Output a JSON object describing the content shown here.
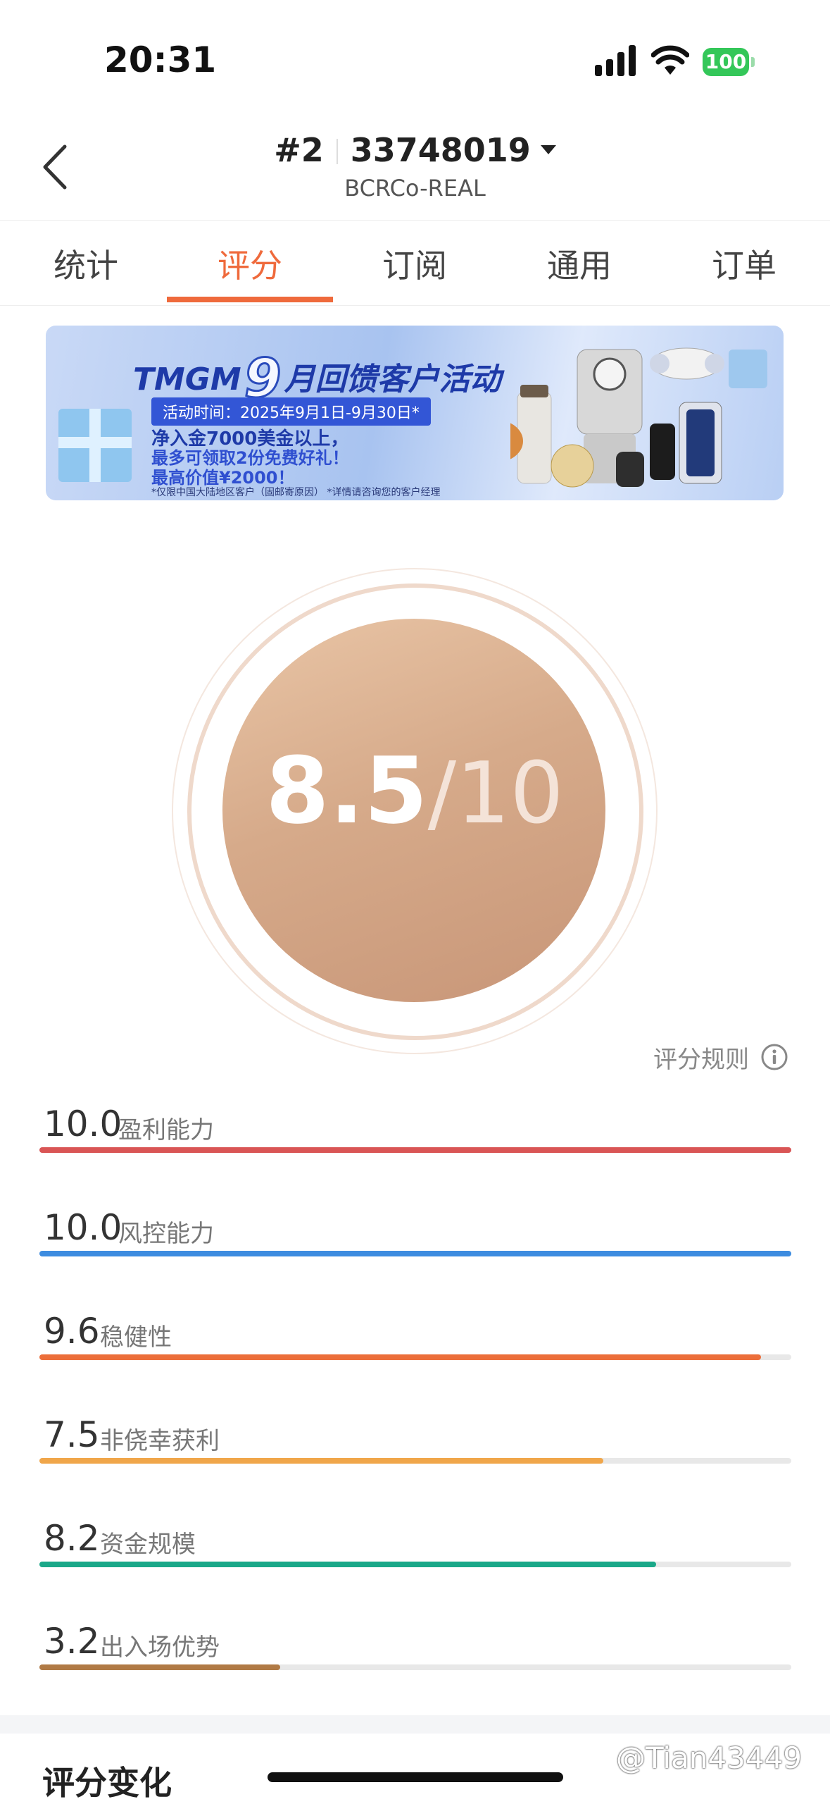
{
  "status_bar": {
    "time": "20:31",
    "battery": "100"
  },
  "header": {
    "rank": "#2",
    "account": "33748019",
    "server": "BCRCo-REAL"
  },
  "tabs": [
    {
      "label": "统计"
    },
    {
      "label": "评分",
      "active": true
    },
    {
      "label": "订阅"
    },
    {
      "label": "通用"
    },
    {
      "label": "订单"
    }
  ],
  "banner": {
    "brand": "TMGM",
    "month": "9",
    "title_rest": "月回馈客户活动",
    "date": "活动时间：2025年9月1日-9月30日*",
    "line1": "净入金7000美金以上，",
    "line2": "最多可领取2份免费好礼！",
    "line3": "最高价值¥2000！",
    "footnote": "*仅限中国大陆地区客户（固邮寄原因） *详情请咨询您的客户经理"
  },
  "score": {
    "value": "8.5",
    "max": "/10"
  },
  "rules_label": "评分规则",
  "metrics": [
    {
      "value": "10.0",
      "label": "盈利能力",
      "fraction": 1.0,
      "color": "#d95555"
    },
    {
      "value": "10.0",
      "label": "风控能力",
      "fraction": 1.0,
      "color": "#3d8ce0"
    },
    {
      "value": "9.6",
      "label": "稳健性",
      "fraction": 0.96,
      "color": "#ec6e3a"
    },
    {
      "value": "7.5",
      "label": "非侥幸获利",
      "fraction": 0.75,
      "color": "#f0a64a"
    },
    {
      "value": "8.2",
      "label": "资金规模",
      "fraction": 0.82,
      "color": "#1aa889"
    },
    {
      "value": "3.2",
      "label": "出入场优势",
      "fraction": 0.32,
      "color": "#b07a45"
    }
  ],
  "section_title": "评分变化",
  "watermark": "@Tian43449"
}
